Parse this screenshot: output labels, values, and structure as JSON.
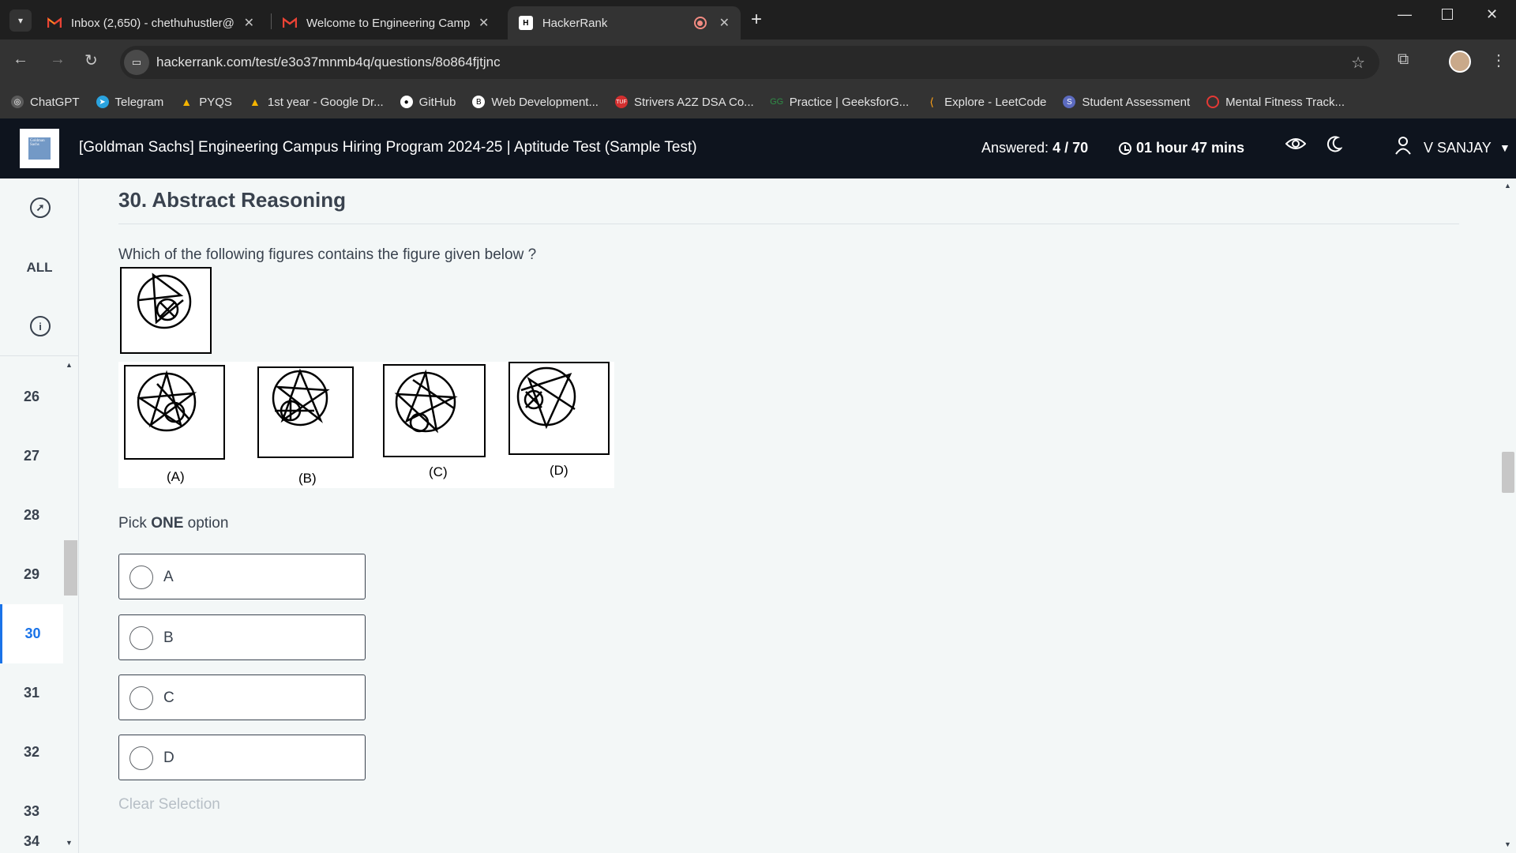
{
  "browser": {
    "tabs": [
      {
        "title": "Inbox (2,650) - chethuhustler@",
        "icon": "gmail-icon"
      },
      {
        "title": "Welcome to Engineering Camp",
        "icon": "gmail-icon"
      },
      {
        "title": "HackerRank",
        "icon": "hackerrank-icon",
        "active": true
      }
    ],
    "url": "hackerrank.com/test/e3o37mnmb4q/questions/8o864fjtjnc",
    "bookmarks": [
      {
        "label": "ChatGPT",
        "icon": "chatgpt-icon",
        "color": "#5b5b5b"
      },
      {
        "label": "Telegram",
        "icon": "telegram-icon",
        "color": "#2aa3df"
      },
      {
        "label": "PYQS",
        "icon": "drive-icon",
        "color": "#f4b400"
      },
      {
        "label": "1st year - Google Dr...",
        "icon": "drive-icon",
        "color": "#f4b400"
      },
      {
        "label": "GitHub",
        "icon": "github-icon",
        "color": "#ffffff"
      },
      {
        "label": "Web Development...",
        "icon": "bookmark-icon",
        "color": "#ffffff"
      },
      {
        "label": "Strivers A2Z DSA Co...",
        "icon": "tuf-icon",
        "color": "#d32f2f"
      },
      {
        "label": "Practice | GeeksforG...",
        "icon": "gfg-icon",
        "color": "#2f8d46"
      },
      {
        "label": "Explore - LeetCode",
        "icon": "leetcode-icon",
        "color": "#ffa116"
      },
      {
        "label": "Student Assessment",
        "icon": "assessment-icon",
        "color": "#5c6bc0"
      },
      {
        "label": "Mental Fitness Track...",
        "icon": "fitness-icon",
        "color": "#e53935"
      }
    ]
  },
  "header": {
    "title": "[Goldman Sachs] Engineering Campus Hiring Program 2024-25 | Aptitude Test (Sample Test)",
    "answered_label": "Answered:",
    "answered_value": "4 / 70",
    "timer": "01 hour 47 mins",
    "username": "V SANJAY",
    "logo_text": "Goldman Sachs"
  },
  "sidebar": {
    "all_label": "ALL",
    "questions": [
      "26",
      "27",
      "28",
      "29",
      "30",
      "31",
      "32",
      "33",
      "34"
    ],
    "active": "30"
  },
  "question": {
    "title": "30. Abstract Reasoning",
    "text": "Which of the following figures contains the figure given below ?",
    "figure_labels": [
      "(A)",
      "(B)",
      "(C)",
      "(D)"
    ],
    "pick_prefix": "Pick ",
    "pick_bold": "ONE",
    "pick_suffix": " option",
    "options": [
      "A",
      "B",
      "C",
      "D"
    ],
    "clear_label": "Clear Selection"
  },
  "colors": {
    "header_bg": "#0e141e",
    "accent": "#1a73e8",
    "page_bg": "#f3f7f7"
  }
}
